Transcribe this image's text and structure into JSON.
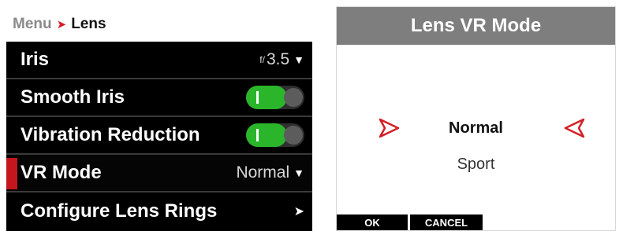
{
  "menu": {
    "breadcrumb": {
      "parent": "Menu",
      "separator": "›",
      "current": "Lens"
    },
    "rows": [
      {
        "label": "Iris",
        "value": "3.5",
        "value_prefix": "f/"
      },
      {
        "label": "Smooth Iris",
        "toggle_on": true
      },
      {
        "label": "Vibration Reduction",
        "toggle_on": true
      },
      {
        "label": "VR Mode",
        "value": "Normal",
        "selected": true
      },
      {
        "label": "Configure Lens Rings",
        "submenu": true
      }
    ]
  },
  "dialog": {
    "title": "Lens VR Mode",
    "options": {
      "selected": "Normal",
      "other": "Sport"
    },
    "softkeys": {
      "ok": "OK",
      "cancel": "CANCEL"
    }
  },
  "colors": {
    "accent_red": "#c4161c",
    "toggle_on": "#2bb52b",
    "header_grey": "#7e7e7e"
  }
}
